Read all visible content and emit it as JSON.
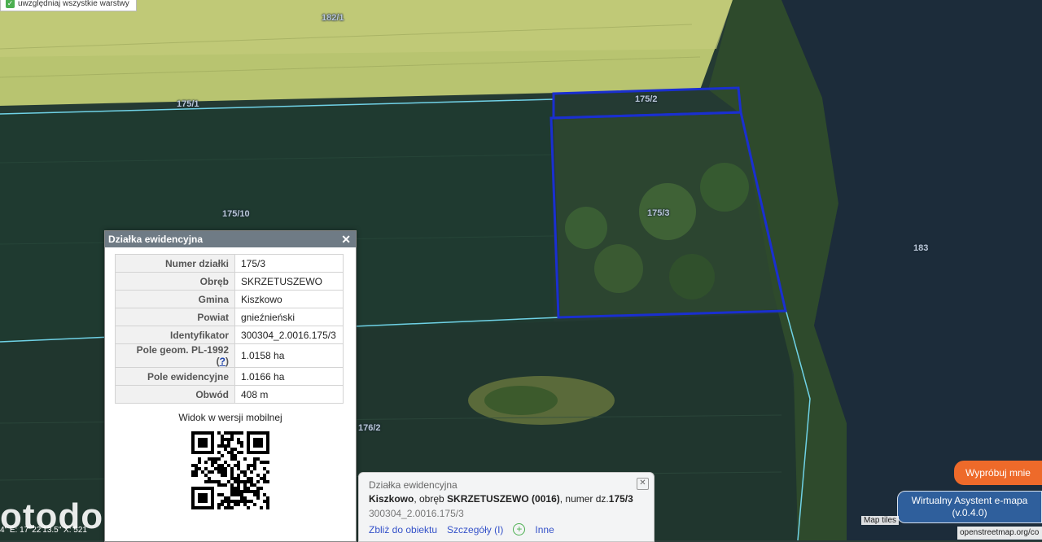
{
  "layers_toggle": {
    "label": "uwzględniaj wszystkie warstwy",
    "checked": true
  },
  "parcel_labels": {
    "p1821": "182/1",
    "p1751": "175/1",
    "p1752": "175/2",
    "p1753": "175/3",
    "p17510": "175/10",
    "p183": "183",
    "p1762": "176/2"
  },
  "info_panel": {
    "title": "Działka ewidencyjna",
    "rows": [
      {
        "key": "Numer działki",
        "value": "175/3"
      },
      {
        "key": "Obręb",
        "value": "SKRZETUSZEWO"
      },
      {
        "key": "Gmina",
        "value": "Kiszkowo"
      },
      {
        "key": "Powiat",
        "value": "gnieźnieński"
      },
      {
        "key": "Identyfikator",
        "value": "300304_2.0016.175/3"
      },
      {
        "key": "Pole geom. PL-1992 (",
        "help": "?",
        "key_end": ")",
        "value": "1.0158 ha"
      },
      {
        "key": "Pole ewidencyjne",
        "value": "1.0166 ha"
      },
      {
        "key": "Obwód",
        "value": "408 m"
      }
    ],
    "mobile_caption": "Widok w wersji mobilnej"
  },
  "bubble": {
    "title": "Działka ewidencyjna",
    "gmina": "Kiszkowo",
    "sep1": ", obręb ",
    "obreb": "SKRZETUSZEWO (0016)",
    "sep2": ", numer dz.",
    "numer": "175/3",
    "identifier": "300304_2.0016.175/3",
    "links": {
      "zoom": "Zbliż do obiektu",
      "details": "Szczegóły (I)",
      "other": "Inne"
    }
  },
  "try_button": "Wypróbuj mnie",
  "assistant": {
    "line1": "Wirtualny Asystent e-mapa",
    "line2": "(v.0.4.0)"
  },
  "attribution": {
    "map_tiles": "Map tiles",
    "osm": "openstreetmap.org/co"
  },
  "coords": "4\" E: 17°22'13.5\" X: 521",
  "watermark": "otodo",
  "colors": {
    "parcel_outline": "#1a2fd0",
    "try_button": "#ee6a2a",
    "assistant": "#2f5f9c"
  }
}
